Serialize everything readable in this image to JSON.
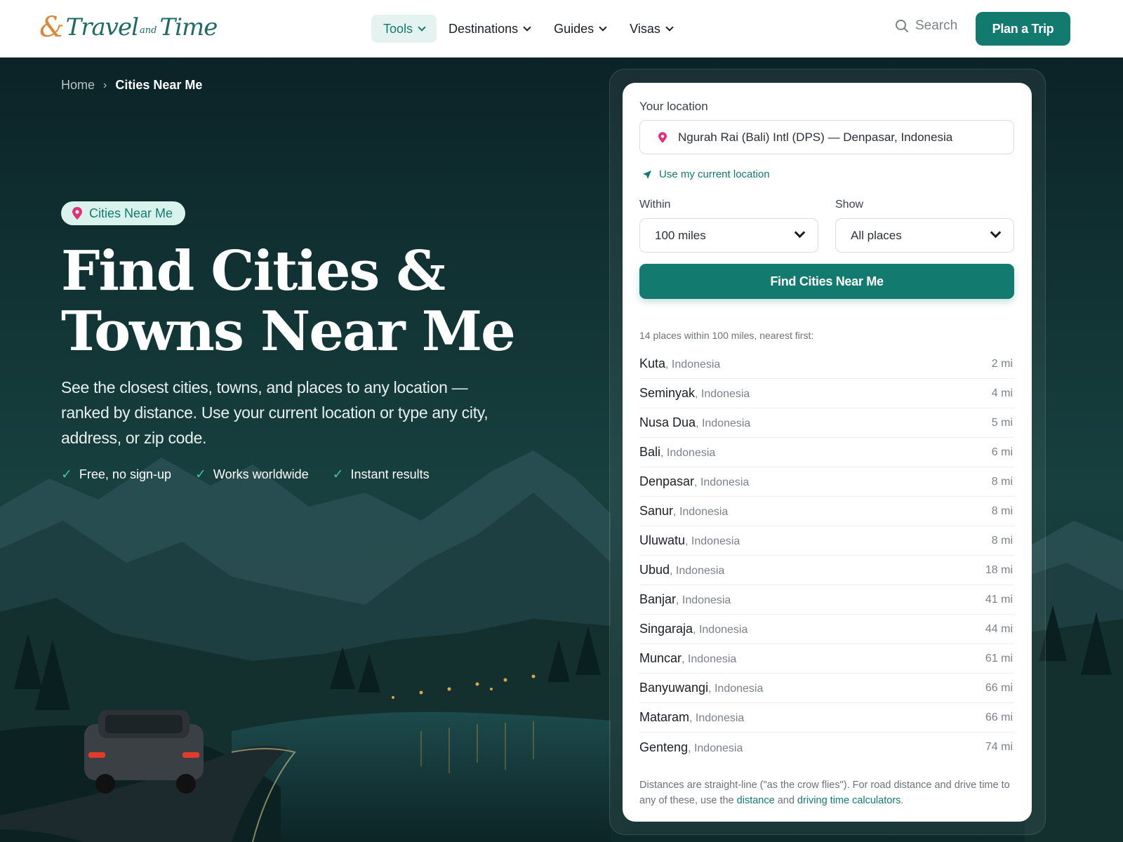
{
  "brand": {
    "logo_amp": "&",
    "logo_word1": "Travel",
    "logo_and": "and",
    "logo_word2": "Time"
  },
  "nav": {
    "items": [
      {
        "label": "Tools",
        "active": true
      },
      {
        "label": "Destinations",
        "active": false
      },
      {
        "label": "Guides",
        "active": false
      },
      {
        "label": "Visas",
        "active": false
      }
    ],
    "search_label": "Search",
    "cta_label": "Plan a Trip"
  },
  "breadcrumb": {
    "home": "Home",
    "current": "Cities Near Me"
  },
  "hero": {
    "pill": "Cities Near Me",
    "title": "Find Cities & Towns Near Me",
    "subtitle": "See the closest cities, towns, and places to any location — ranked by distance. Use your current location or type any city, address, or zip code.",
    "checks": [
      "Free, no sign-up",
      "Works worldwide",
      "Instant results"
    ]
  },
  "finder": {
    "location_label": "Your location",
    "location_value": "Ngurah Rai (Bali) Intl (DPS) — Denpasar, Indonesia",
    "use_current": "Use my current location",
    "within_label": "Within",
    "within_value": "100 miles",
    "show_label": "Show",
    "show_value": "All places",
    "button": "Find Cities Near Me",
    "summary": "14 places within 100 miles, nearest first:",
    "results": [
      {
        "city": "Kuta",
        "country": ", Indonesia",
        "dist": "2 mi"
      },
      {
        "city": "Seminyak",
        "country": ", Indonesia",
        "dist": "4 mi"
      },
      {
        "city": "Nusa Dua",
        "country": ", Indonesia",
        "dist": "5 mi"
      },
      {
        "city": "Bali",
        "country": ", Indonesia",
        "dist": "6 mi"
      },
      {
        "city": "Denpasar",
        "country": ", Indonesia",
        "dist": "8 mi"
      },
      {
        "city": "Sanur",
        "country": ", Indonesia",
        "dist": "8 mi"
      },
      {
        "city": "Uluwatu",
        "country": ", Indonesia",
        "dist": "8 mi"
      },
      {
        "city": "Ubud",
        "country": ", Indonesia",
        "dist": "18 mi"
      },
      {
        "city": "Banjar",
        "country": ", Indonesia",
        "dist": "41 mi"
      },
      {
        "city": "Singaraja",
        "country": ", Indonesia",
        "dist": "44 mi"
      },
      {
        "city": "Muncar",
        "country": ", Indonesia",
        "dist": "61 mi"
      },
      {
        "city": "Banyuwangi",
        "country": ", Indonesia",
        "dist": "66 mi"
      },
      {
        "city": "Mataram",
        "country": ", Indonesia",
        "dist": "66 mi"
      },
      {
        "city": "Genteng",
        "country": ", Indonesia",
        "dist": "74 mi"
      }
    ],
    "note_pre": "Distances are straight-line (\"as the crow flies\"). For road distance and drive time to any of these, use the ",
    "note_link1": "distance",
    "note_mid": " and ",
    "note_link2": "driving time calculators",
    "note_post": "."
  },
  "colors": {
    "accent": "#137a6f",
    "accent_light": "#e5f3f0",
    "pin": "#e0307a",
    "check": "#3fc1a8",
    "hero_bg": "#0f2a2e"
  },
  "icons": {
    "search": "search-icon",
    "pin": "map-pin-icon",
    "locate": "navigation-arrow-icon",
    "check": "checkmark-icon",
    "chevron": "chevron-down-icon",
    "breadcrumb_sep": "chevron-right-icon"
  }
}
